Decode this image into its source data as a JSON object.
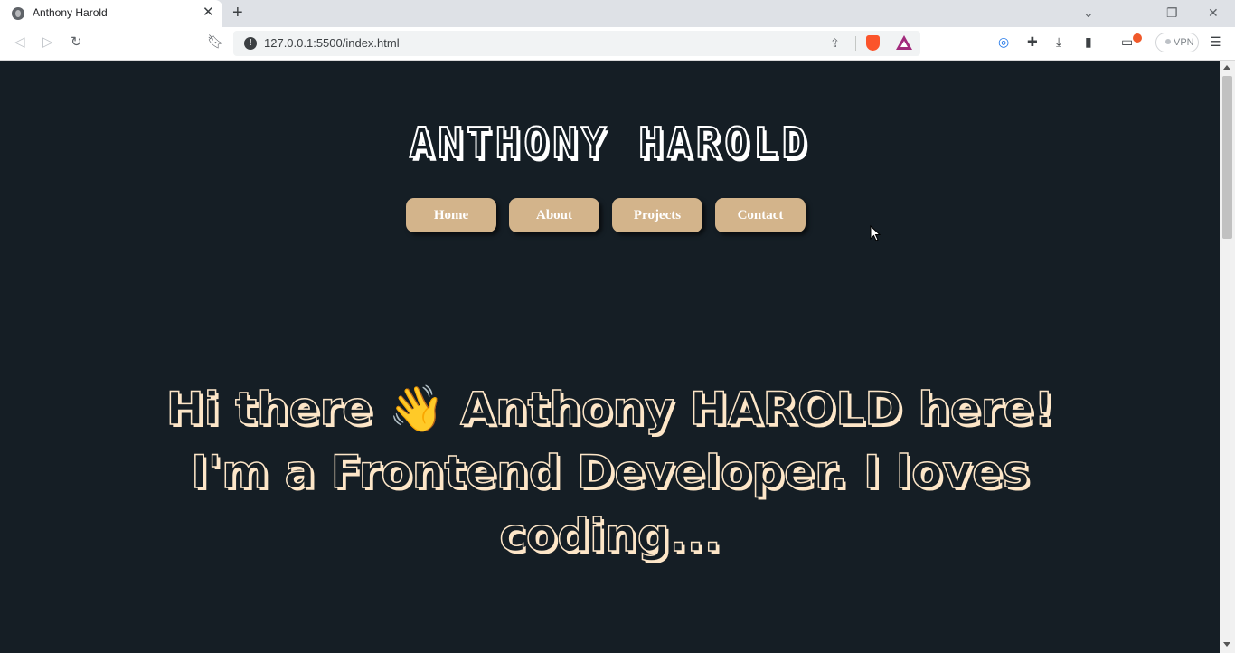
{
  "browser": {
    "tab_title": "Anthony Harold",
    "url": "127.0.0.1:5500/index.html",
    "vpn_label": "VPN",
    "icons": [
      "globe-icon",
      "close-icon",
      "plus-icon",
      "chevron-down-icon",
      "minimize-icon",
      "restore-icon",
      "window-close-icon",
      "back-icon",
      "forward-icon",
      "reload-icon",
      "bookmark-icon",
      "info-icon",
      "share-icon",
      "brave-shield-icon",
      "bat-rewards-icon",
      "sync-icon",
      "extensions-icon",
      "download-icon",
      "sidebar-icon",
      "wallet-icon",
      "menu-icon"
    ]
  },
  "site": {
    "title": "ANTHONY HAROLD",
    "nav": [
      "Home",
      "About",
      "Projects",
      "Contact"
    ],
    "hero_line1_a": "Hi there",
    "hero_wave": "👋",
    "hero_line1_b": "Anthony HAROLD here!",
    "hero_line2": "I'm a Frontend Developer. I loves coding..."
  },
  "colors": {
    "page_bg": "#151e25",
    "button_bg": "#d3b48b",
    "hero_text": "#fde6c8"
  }
}
